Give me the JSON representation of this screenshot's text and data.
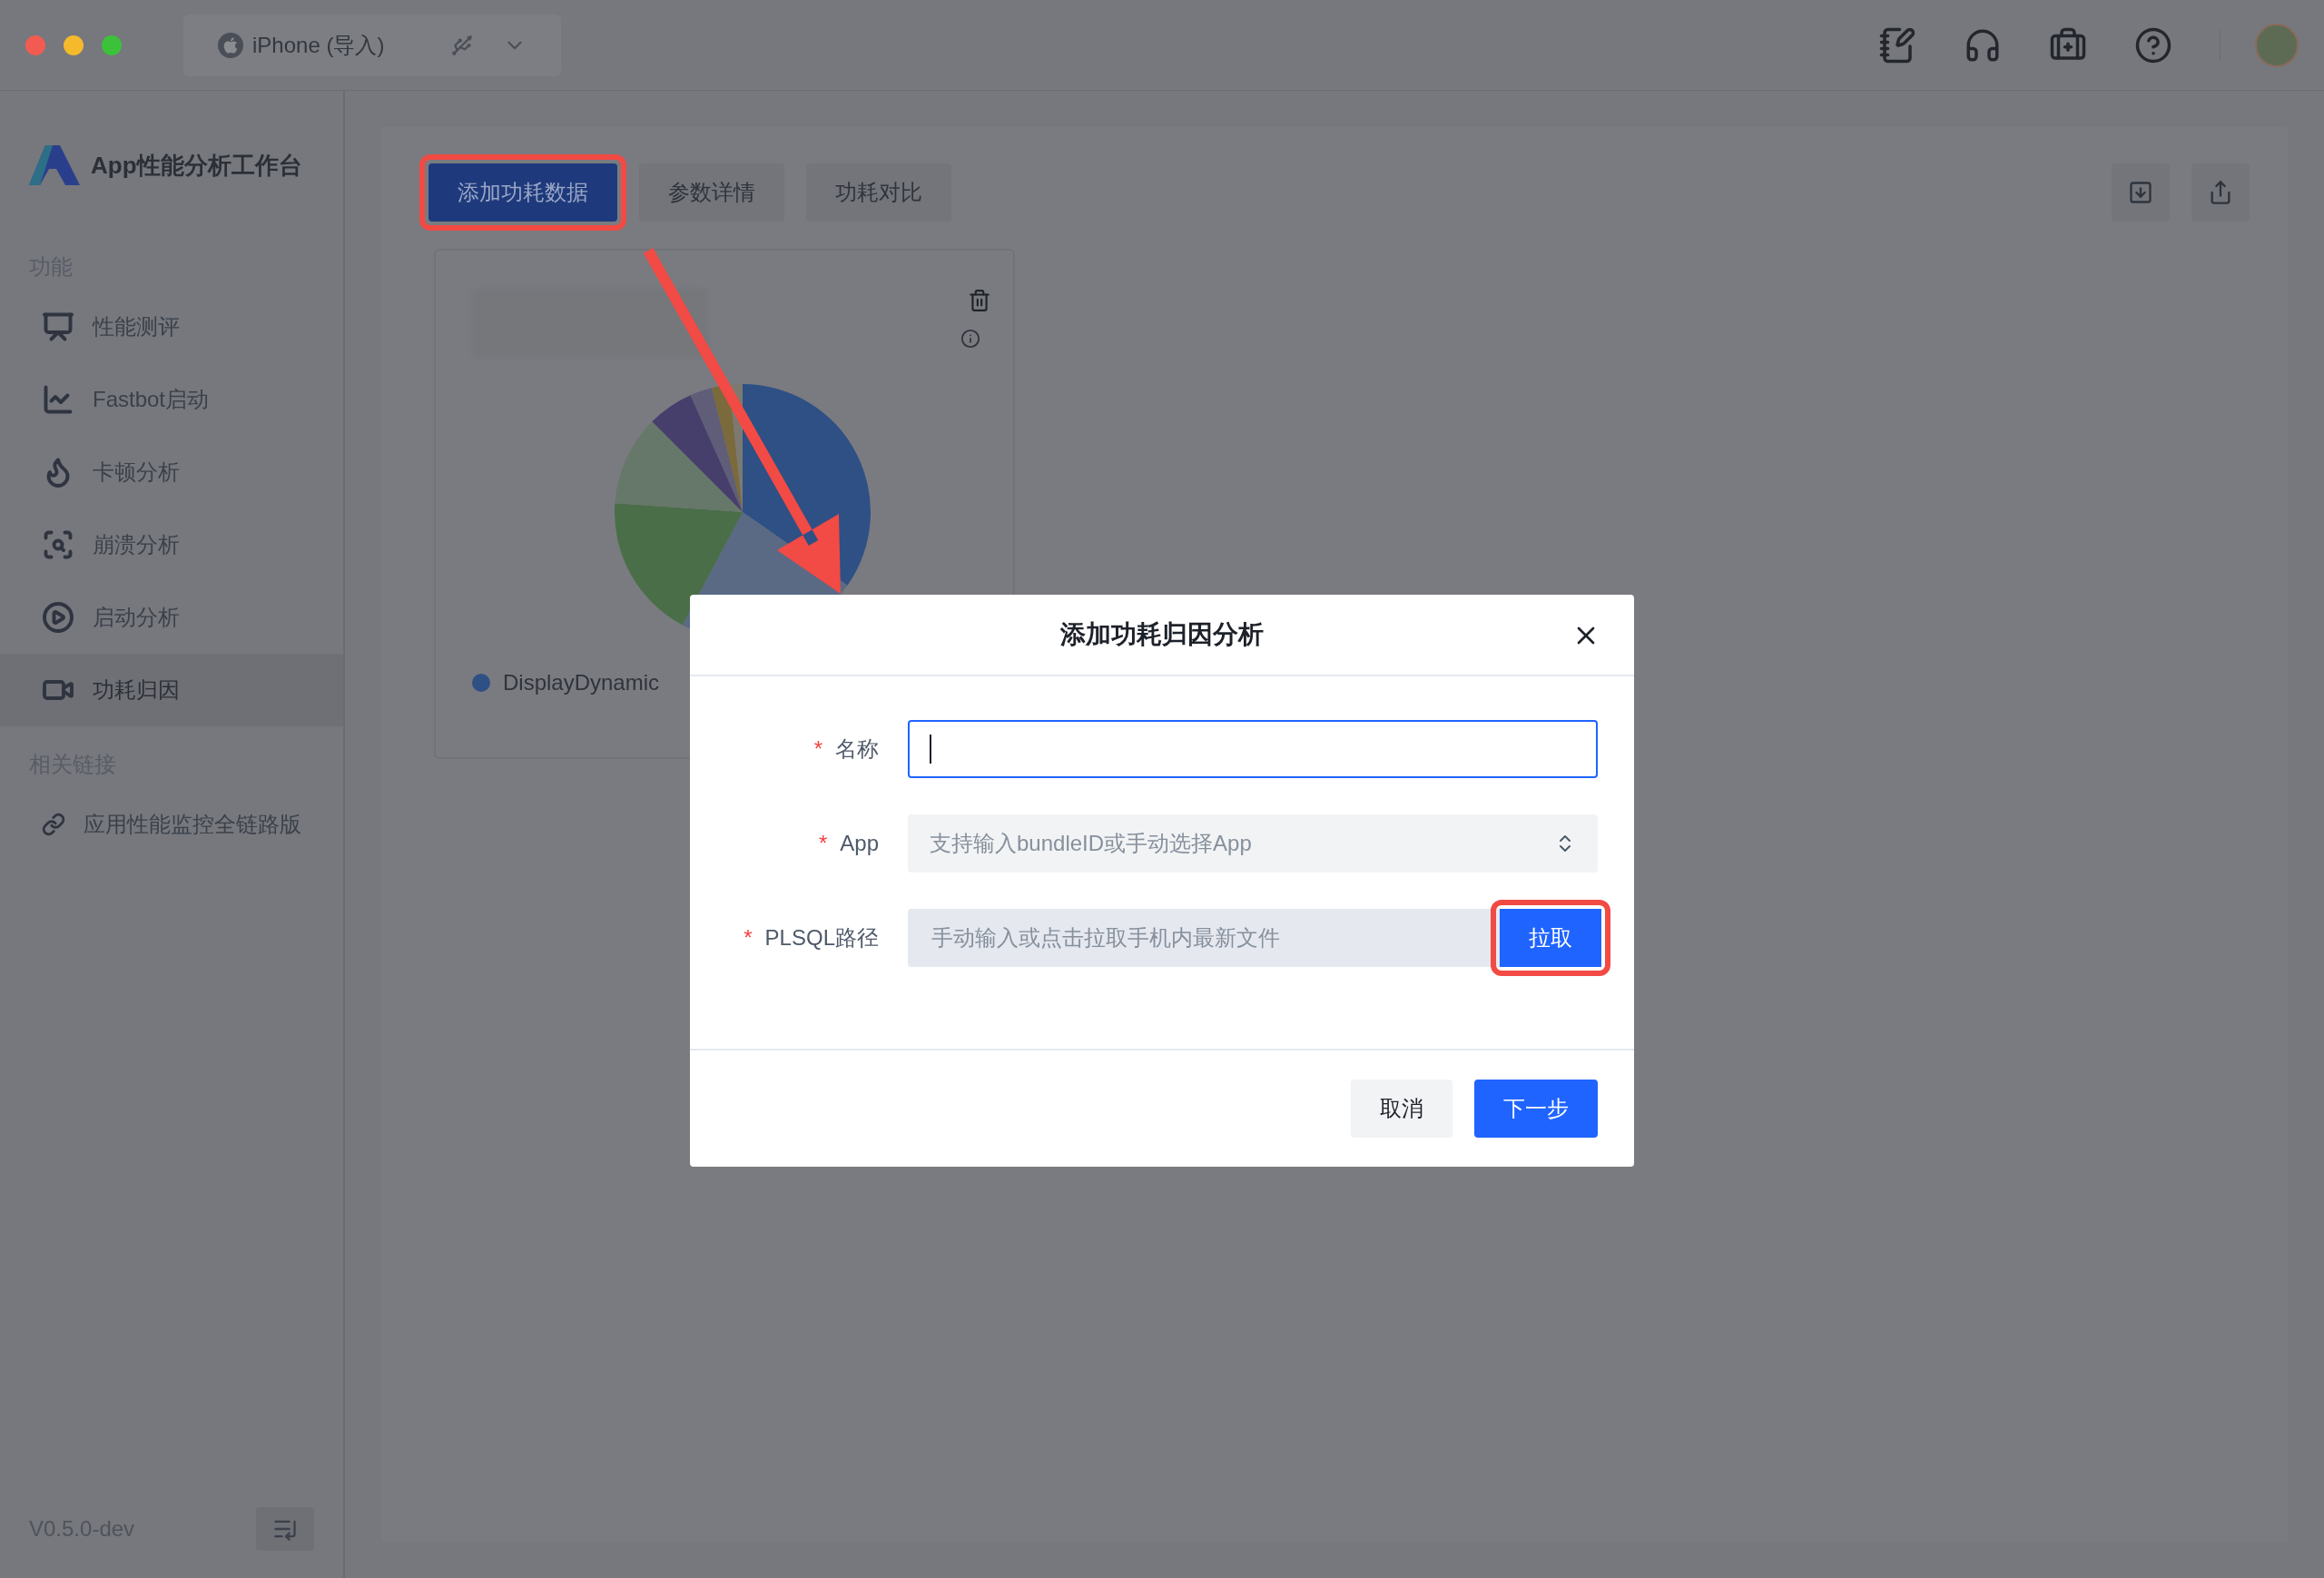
{
  "window": {
    "device_selector": "iPhone (导入)"
  },
  "sidebar": {
    "title": "App性能分析工作台",
    "sections": [
      {
        "label": "功能",
        "items": [
          {
            "label": "性能测评",
            "selected": false
          },
          {
            "label": "Fastbot启动",
            "selected": false
          },
          {
            "label": "卡顿分析",
            "selected": false
          },
          {
            "label": "崩溃分析",
            "selected": false
          },
          {
            "label": "启动分析",
            "selected": false
          },
          {
            "label": "功耗归因",
            "selected": true
          }
        ]
      },
      {
        "label": "相关链接",
        "items": [
          {
            "label": "应用性能监控全链路版",
            "selected": false
          }
        ]
      }
    ],
    "version": "V0.5.0-dev"
  },
  "tabs": [
    {
      "label": "添加功耗数据",
      "selected": true,
      "highlighted": true
    },
    {
      "label": "参数详情",
      "selected": false,
      "highlighted": false
    },
    {
      "label": "功耗对比",
      "selected": false,
      "highlighted": false
    }
  ],
  "card": {
    "legend": [
      {
        "label": "DisplayDynamic",
        "color": "#2e5085"
      }
    ]
  },
  "dialog": {
    "title": "添加功耗归因分析",
    "fields": [
      {
        "kind": "text",
        "label": "名称",
        "required_mark": "*",
        "focused": true
      },
      {
        "kind": "select",
        "label": "App",
        "required_mark": "*",
        "placeholder": "支持输入bundleID或手动选择App"
      },
      {
        "kind": "pull",
        "label": "PLSQL路径",
        "required_mark": "*",
        "placeholder": "手动输入或点击拉取手机内最新文件",
        "button": {
          "label": "拉取",
          "highlighted": true
        }
      }
    ],
    "buttons": [
      {
        "label": "取消",
        "kind": "secondary"
      },
      {
        "label": "下一步",
        "kind": "primary"
      }
    ]
  }
}
